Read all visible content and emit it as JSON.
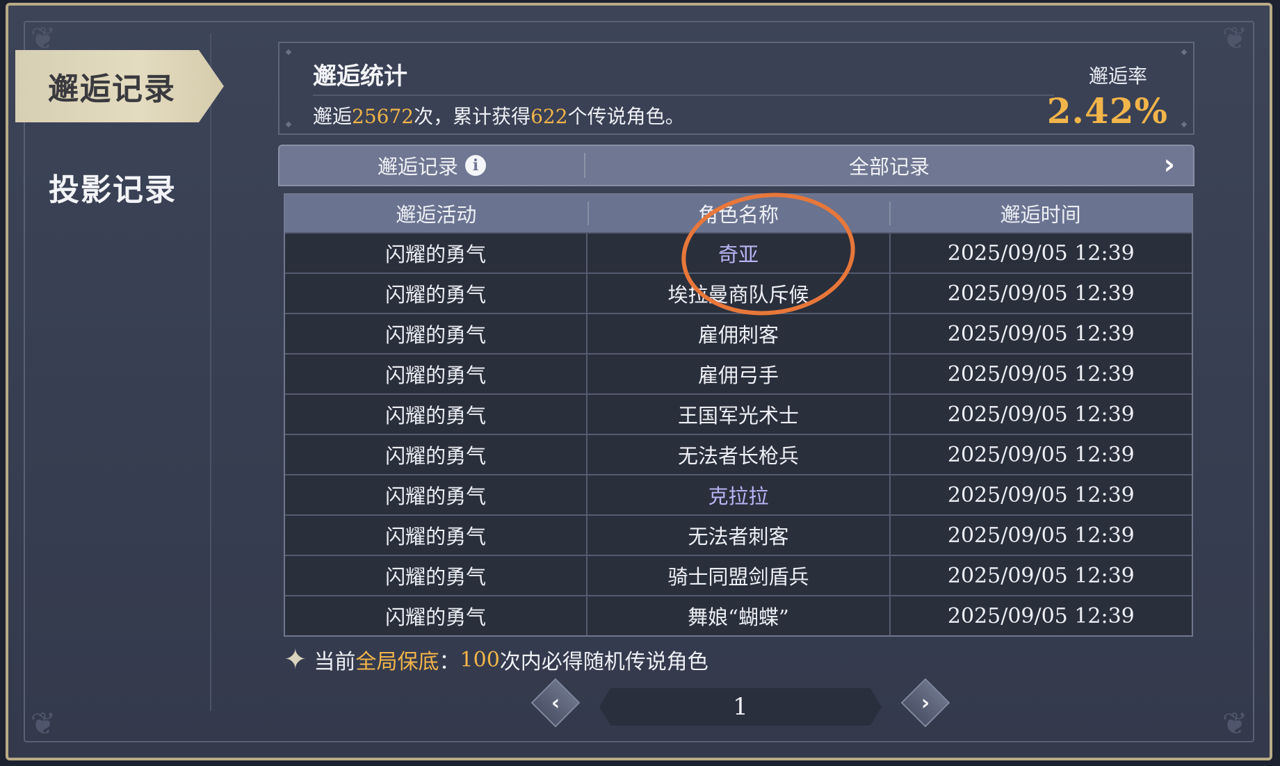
{
  "sidebar": {
    "items": [
      {
        "label": "邂逅记录",
        "active": true
      },
      {
        "label": "投影记录",
        "active": false
      }
    ]
  },
  "stats": {
    "title": "邂逅统计",
    "desc_prefix": "邂逅",
    "total_count": "25672",
    "desc_mid": "次，累计获得",
    "legend_count": "622",
    "desc_suffix": "个传说角色。",
    "rate_label": "邂逅率",
    "rate_value": "2.42%"
  },
  "filter": {
    "left_label": "邂逅记录",
    "info_icon": "i",
    "right_label": "全部记录",
    "arrow": "›"
  },
  "table": {
    "headers": [
      "邂逅活动",
      "角色名称",
      "邂逅时间"
    ],
    "rows": [
      {
        "activity": "闪耀的勇气",
        "name": "奇亚",
        "time": "2025/09/05 12:39",
        "legend": true
      },
      {
        "activity": "闪耀的勇气",
        "name": "埃拉曼商队斥候",
        "time": "2025/09/05 12:39",
        "legend": false
      },
      {
        "activity": "闪耀的勇气",
        "name": "雇佣刺客",
        "time": "2025/09/05 12:39",
        "legend": false
      },
      {
        "activity": "闪耀的勇气",
        "name": "雇佣弓手",
        "time": "2025/09/05 12:39",
        "legend": false
      },
      {
        "activity": "闪耀的勇气",
        "name": "王国军光术士",
        "time": "2025/09/05 12:39",
        "legend": false
      },
      {
        "activity": "闪耀的勇气",
        "name": "无法者长枪兵",
        "time": "2025/09/05 12:39",
        "legend": false
      },
      {
        "activity": "闪耀的勇气",
        "name": "克拉拉",
        "time": "2025/09/05 12:39",
        "legend": true
      },
      {
        "activity": "闪耀的勇气",
        "name": "无法者刺客",
        "time": "2025/09/05 12:39",
        "legend": false
      },
      {
        "activity": "闪耀的勇气",
        "name": "骑士同盟剑盾兵",
        "time": "2025/09/05 12:39",
        "legend": false
      },
      {
        "activity": "闪耀的勇气",
        "name": "舞娘“蝴蝶”",
        "time": "2025/09/05 12:39",
        "legend": false
      }
    ]
  },
  "guarantee": {
    "star": "✦",
    "prefix": "当前",
    "highlight": "全局保底",
    "colon": "：",
    "count": "100",
    "suffix": "次内必得随机传说角色"
  },
  "pagination": {
    "prev": "‹",
    "page": "1",
    "next": "›"
  },
  "colors": {
    "accent": "#f2b54a",
    "legend_name": "#b9b4f3",
    "annotation": "#e8773a"
  }
}
